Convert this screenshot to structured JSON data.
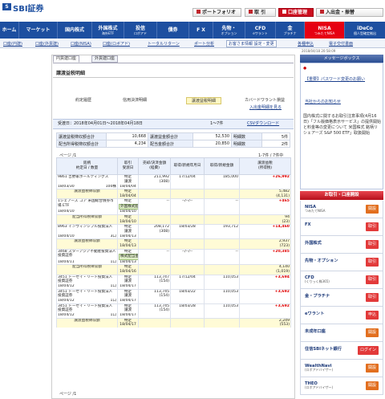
{
  "header": {
    "logo_mark": "S",
    "brand": "SBI証券",
    "topbuttons": [
      {
        "label": "ポートフォリオ"
      },
      {
        "label": "取 引"
      },
      {
        "label": "口座管理"
      },
      {
        "label": "入出金・振替"
      }
    ]
  },
  "nav": [
    {
      "label": "ホーム"
    },
    {
      "label": "マーケット"
    },
    {
      "label": "国内株式"
    },
    {
      "label": "外国株式",
      "sub": "海外ETF"
    },
    {
      "label": "投信",
      "sub": "ロボアド"
    },
    {
      "label": "債券"
    },
    {
      "label": "F X"
    },
    {
      "label": "先物・",
      "sub": "オプション"
    },
    {
      "label": "CFD",
      "sub": "eワラント"
    },
    {
      "label": "金",
      "sub": "プラチナ"
    },
    {
      "label": "NISA",
      "sub": "つみたてNISA"
    },
    {
      "label": "iDeCo",
      "sub": "個人型確定拠出"
    }
  ],
  "subnav": [
    "口座(円建)",
    "口座(外貨建)",
    "口座(NISA)",
    "口座(ロボアド)",
    "トータルリターン",
    "ポート分析",
    "お客さま情報 設定・変更",
    "各種申込",
    "電子交付書面"
  ],
  "timestamp": "2018/04/18 20:58:09",
  "tabs": [
    "円貨建口座",
    "外貨建口座"
  ],
  "title": "譲渡益税明細",
  "modes": [
    "約定履歴",
    "信用決済明細",
    "譲渡益税明細",
    "カバードワラント損益",
    "入出金明細を見る"
  ],
  "info": {
    "period": "受渡日：2018年04月01日～2018年04月18日",
    "count": "1～7件",
    "csv": "CSVダウンロード"
  },
  "summary": [
    [
      "譲渡益税徴収額合計",
      "10,668",
      "譲渡益金額合計",
      "52,530",
      "明細数",
      "5件"
    ],
    [
      "配当所得税徴収額合計",
      "4,234",
      "配当金額合計",
      "20,850",
      "明細数",
      "2件"
    ]
  ],
  "paging_top": "ページ /1",
  "paging_right": "1-7件 / 7件中",
  "columns": [
    "銘柄",
    "取引",
    "売却/決済金額",
    "取得/新規年月日",
    "取得/新規金額",
    "譲渡益税"
  ],
  "columns_sub": [
    "約定日 / 数量",
    "受渡日",
    "(経費)",
    "",
    "",
    "(所得税)"
  ],
  "rows": [
    {
      "name": "9861 吉野家ホールディングス",
      "date": "18/03/30",
      "qty": "100株",
      "kind": "特定",
      "type": "譲渡",
      "settle": "18/04/04",
      "amount": "211,992",
      "fee": "(308)",
      "acq_date": "17/12/04",
      "acq_amt": "185,000",
      "gain": "+26,992"
    },
    {
      "name": "譲渡益税徴収額",
      "kind": "特定",
      "settle": "18/04/04",
      "tax1": "5,482",
      "tax2": "(4,131)"
    },
    {
      "name": "1シェアーズ コア 米国総合債券市場 ETF",
      "date": "18/04/10",
      "qty": "",
      "kind": "特定",
      "type": "外国株式配当金",
      "settle": "18/04/10",
      "amount": "--",
      "fee": "",
      "acq_date": "--/--/--",
      "acq_amt": "--",
      "gain": "+465"
    },
    {
      "name": "配当所得税徴収額",
      "kind": "特定",
      "settle": "18/04/10",
      "tax1": "94",
      "tax2": "(23)"
    },
    {
      "name": "8963 インヴィンシブル投資法人",
      "date": "18/04/10",
      "qty": "3口",
      "kind": "特定",
      "type": "譲渡",
      "settle": "18/04/13",
      "amount": "208,172",
      "fee": "(308)",
      "acq_date": "18/03/28",
      "acq_amt": "193,712",
      "gain": "+14,460"
    },
    {
      "name": "譲渡益税徴収額",
      "kind": "特定",
      "settle": "18/04/13",
      "tax1": "2,937",
      "tax2": "(723)"
    },
    {
      "name": "3468 スターアジア不動産投資法人 投資証券",
      "date": "18/04/11",
      "qty": "1口",
      "kind": "特定",
      "type": "株式配当金",
      "settle": "18/04/13",
      "amount": "--",
      "fee": "",
      "acq_date": "--/--/--",
      "acq_amt": "--",
      "gain": "+20,385"
    },
    {
      "name": "配当所得税徴収額",
      "kind": "特定",
      "settle": "18/04/16",
      "tax1": "4,140",
      "tax2": "(1,019)"
    },
    {
      "name": "3451 トーセイ・リート投資法人 投資証券",
      "date": "18/04/12",
      "qty": "1口",
      "kind": "特定",
      "type": "譲渡",
      "settle": "18/04/17",
      "amount": "113,747",
      "fee": "(154)",
      "acq_date": "17/12/04",
      "acq_amt": "110,053",
      "gain": "+3,694"
    },
    {
      "name": "3451 トーセイ・リート投資法人 投資証券",
      "date": "18/04/12",
      "qty": "1口",
      "kind": "特定",
      "type": "譲渡",
      "settle": "18/04/17",
      "amount": "113,745",
      "fee": "(154)",
      "acq_date": "18/03/22",
      "acq_amt": "110,053",
      "gain": "+3,692"
    },
    {
      "name": "3451 トーセイ・リート投資法人 投資証券",
      "date": "18/04/12",
      "qty": "1口",
      "kind": "特定",
      "type": "譲渡",
      "settle": "18/04/17",
      "amount": "113,745",
      "fee": "(154)",
      "acq_date": "18/03/28",
      "acq_amt": "110,053",
      "gain": "+3,692"
    },
    {
      "name": "譲渡益税徴収額",
      "kind": "特定",
      "settle": "18/04/17",
      "tax1": "2,249",
      "tax2": "(553)"
    }
  ],
  "paging_bottom": "ページ /1",
  "sidebar": {
    "msg_head": "メッセージボックス",
    "msg_important": "【重要】パスワード変更のお願い",
    "msg_more": "当社からのお知らせ",
    "msg_notice": "国内株式に関するお取引注意事項(4月16日)「フル版価格表示サービス」の提供開始と料金等の変更について 米国株式 銘柄リシェアーズ S&P 500 ETF」取扱開始",
    "order_head": "お取引・口座開設",
    "items": [
      {
        "label": "NISA",
        "sub": "つみたてNISA",
        "btn": "開設"
      },
      {
        "label": "FX",
        "sub": "",
        "btn": "取引"
      },
      {
        "label": "外国株式",
        "sub": "",
        "btn": "取引"
      },
      {
        "label": "先物・オプション",
        "sub": "",
        "btn": "取引"
      },
      {
        "label": "CFD",
        "sub": "(くりっく株365)",
        "btn": "取引"
      },
      {
        "label": "金・プラチナ",
        "sub": "",
        "btn": "取引"
      },
      {
        "label": "eワラント",
        "sub": "",
        "btn": "申込"
      },
      {
        "label": "未成年口座",
        "sub": "",
        "btn": "開設"
      },
      {
        "label": "住信SBIネット銀行",
        "sub": "",
        "btn": "ログイン"
      },
      {
        "label": "WealthNavi",
        "sub": "(ロボアドバイザー)",
        "btn": "開設"
      },
      {
        "label": "THEO",
        "sub": "(ロボアドバイザー)",
        "btn": "開設"
      }
    ]
  }
}
